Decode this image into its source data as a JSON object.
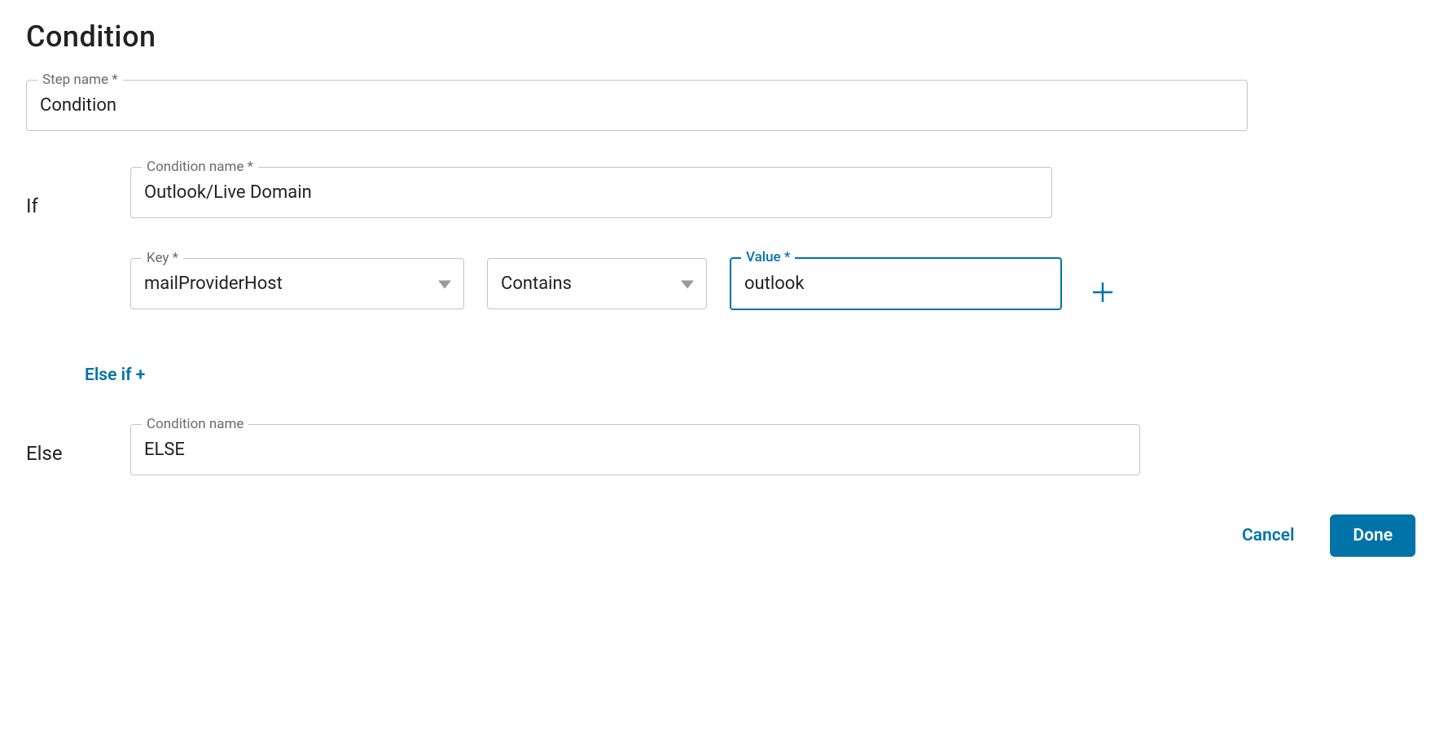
{
  "page": {
    "title": "Condition"
  },
  "step_name": {
    "label": "Step name *",
    "value": "Condition"
  },
  "if_block": {
    "row_label": "If",
    "condition_name": {
      "label": "Condition name *",
      "value": "Outlook/Live Domain"
    },
    "rule": {
      "key": {
        "label": "Key *",
        "value": "mailProviderHost"
      },
      "operator": {
        "value": "Contains"
      },
      "value": {
        "label": "Value *",
        "value": "outlook"
      }
    }
  },
  "elseif": {
    "label": "Else if +"
  },
  "else_block": {
    "row_label": "Else",
    "condition_name": {
      "label": "Condition name",
      "value": "ELSE"
    }
  },
  "footer": {
    "cancel": "Cancel",
    "done": "Done"
  }
}
